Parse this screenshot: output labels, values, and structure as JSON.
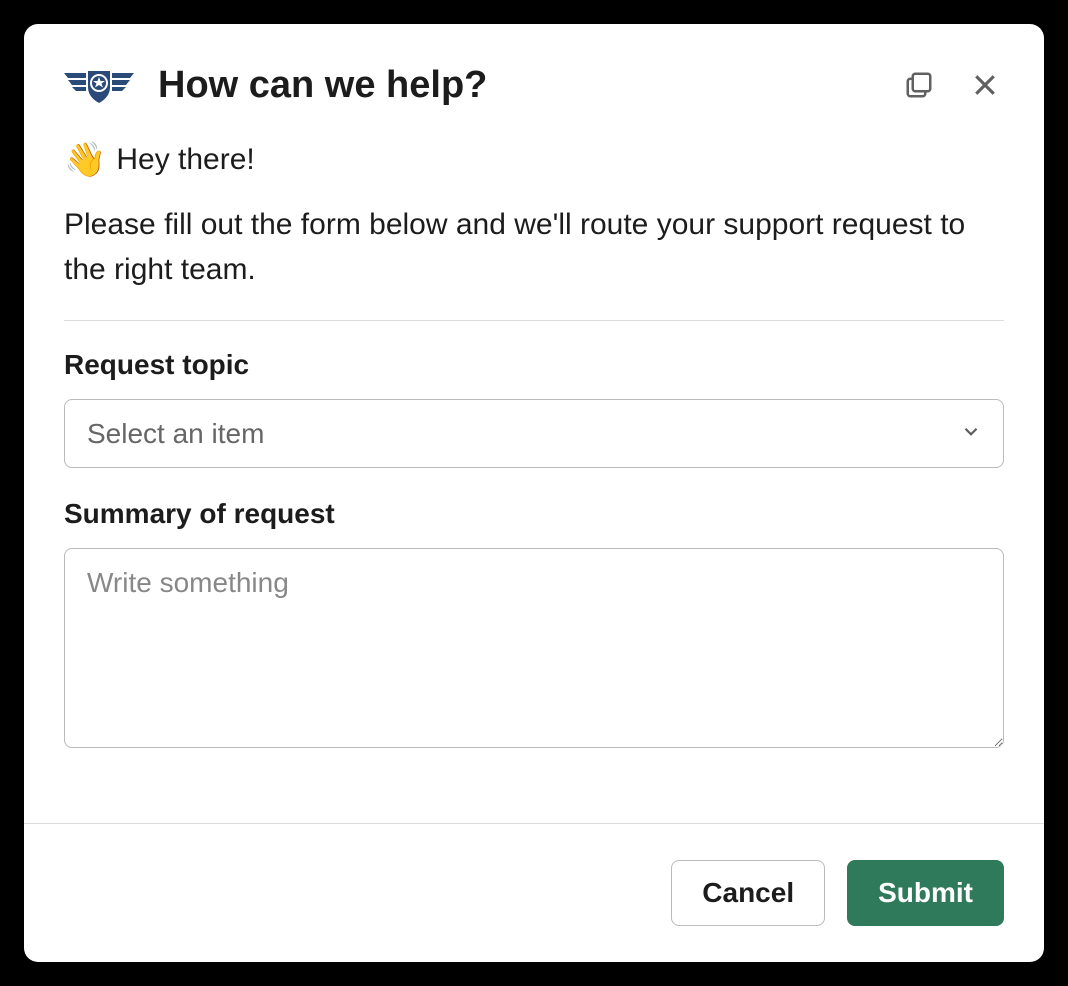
{
  "header": {
    "title": "How can we help?"
  },
  "body": {
    "greeting_emoji": "👋",
    "greeting_text": "Hey there!",
    "instructions": "Please fill out the form below and we'll route your support request to the right team.",
    "request_topic": {
      "label": "Request topic",
      "placeholder": "Select an item"
    },
    "summary": {
      "label": "Summary of request",
      "placeholder": "Write something"
    }
  },
  "footer": {
    "cancel_label": "Cancel",
    "submit_label": "Submit"
  }
}
